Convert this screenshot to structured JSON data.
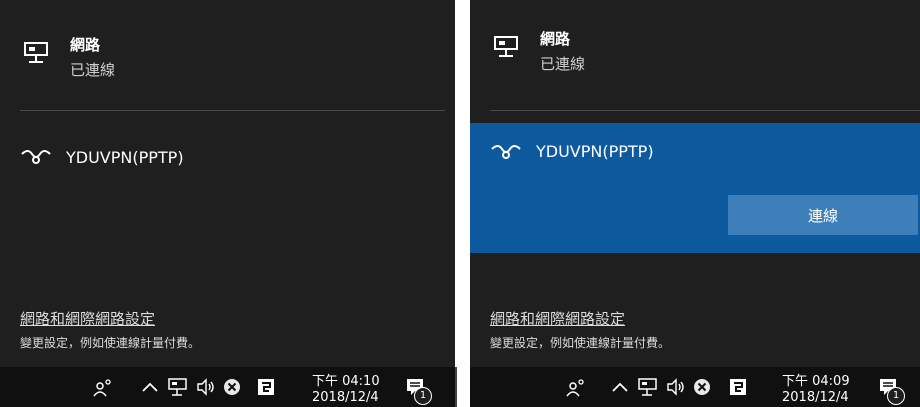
{
  "panels": [
    {
      "network": {
        "title": "網路",
        "status": "已連線"
      },
      "vpn": {
        "name": "YDUVPN(PPTP)"
      },
      "settings": {
        "link": "網路和網際網路設定",
        "description": "變更設定，例如使連線計量付費。"
      },
      "clock": {
        "time": "下午 04:10",
        "date": "2018/12/4"
      },
      "notification_count": "1"
    },
    {
      "network": {
        "title": "網路",
        "status": "已連線"
      },
      "vpn": {
        "name": "YDUVPN(PPTP)",
        "selected": true,
        "connect_label": "連線"
      },
      "settings": {
        "link": "網路和網際網路設定",
        "description": "變更設定，例如使連線計量付費。"
      },
      "clock": {
        "time": "下午 04:09",
        "date": "2018/12/4"
      },
      "notification_count": "1"
    }
  ],
  "colors": {
    "background": "#1f1f1f",
    "accent": "#0e5a9e",
    "button": "#3e7fb9",
    "taskbar": "#101010"
  },
  "icons": [
    "network-icon",
    "vpn-icon",
    "people-icon",
    "chevron-up-icon",
    "volume-icon",
    "error-icon",
    "app-icon",
    "action-center-icon"
  ]
}
